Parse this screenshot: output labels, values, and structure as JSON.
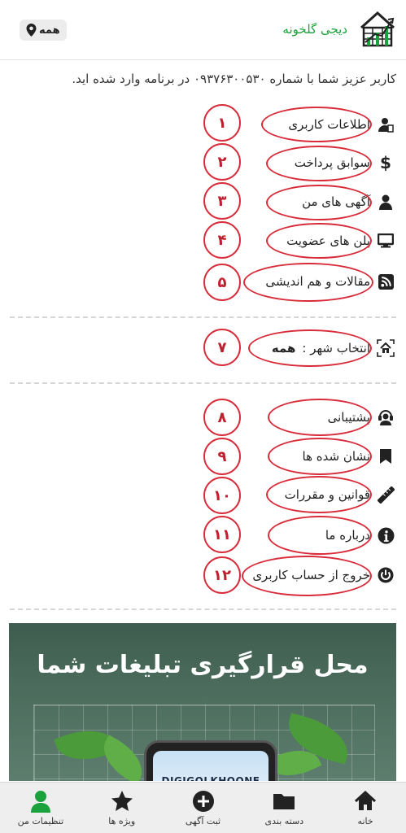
{
  "header": {
    "app_name": "دیجی گلخونه",
    "location_label": "همه"
  },
  "welcome_text": "کاربر عزیز شما با شماره ۰۹۳۷۶۳۰۰۵۳۰ در برنامه وارد شده اید.",
  "menu_group1": [
    {
      "label": "اطلاعات کاربری",
      "icon": "user-info-icon",
      "number": "۱"
    },
    {
      "label": "سوابق پرداخت",
      "icon": "dollar-icon",
      "number": "۲"
    },
    {
      "label": "آگهی های من",
      "icon": "user-ads-icon",
      "number": "۳"
    },
    {
      "label": "پلن های عضویت",
      "icon": "monitor-icon",
      "number": "۴"
    },
    {
      "label": "مقالات و هم اندیشی",
      "icon": "rss-icon",
      "number": "۵"
    }
  ],
  "city": {
    "label": "انتخاب شهر :",
    "value": "همه",
    "icon": "city-house-icon",
    "number": "۷"
  },
  "menu_group2": [
    {
      "label": "پشتیبانی",
      "icon": "support-headset-icon",
      "number": "۸"
    },
    {
      "label": "نشان شده ها",
      "icon": "bookmark-icon",
      "number": "۹"
    },
    {
      "label": "قوانین و مقررات",
      "icon": "ruler-icon",
      "number": "۱۰"
    },
    {
      "label": "درباره ما",
      "icon": "info-icon",
      "number": "۱۱"
    },
    {
      "label": "خروج از حساب کاربری",
      "icon": "power-icon",
      "number": "۱۲"
    }
  ],
  "banner": {
    "title": "محل قرارگیری تبلیغات شما",
    "phone_text": "DIGIGOLKHOONE"
  },
  "bottom_nav": [
    {
      "label": "خانه",
      "icon": "home-icon"
    },
    {
      "label": "دسته بندی",
      "icon": "folder-icon"
    },
    {
      "label": "ثبت آگهی",
      "icon": "add-circle-icon"
    },
    {
      "label": "ویژه ها",
      "icon": "star-icon"
    },
    {
      "label": "تنظیمات من",
      "icon": "user-settings-icon",
      "active": true
    }
  ],
  "colors": {
    "brand_green": "#1aa23c",
    "annotation_red": "#d82c3a"
  }
}
